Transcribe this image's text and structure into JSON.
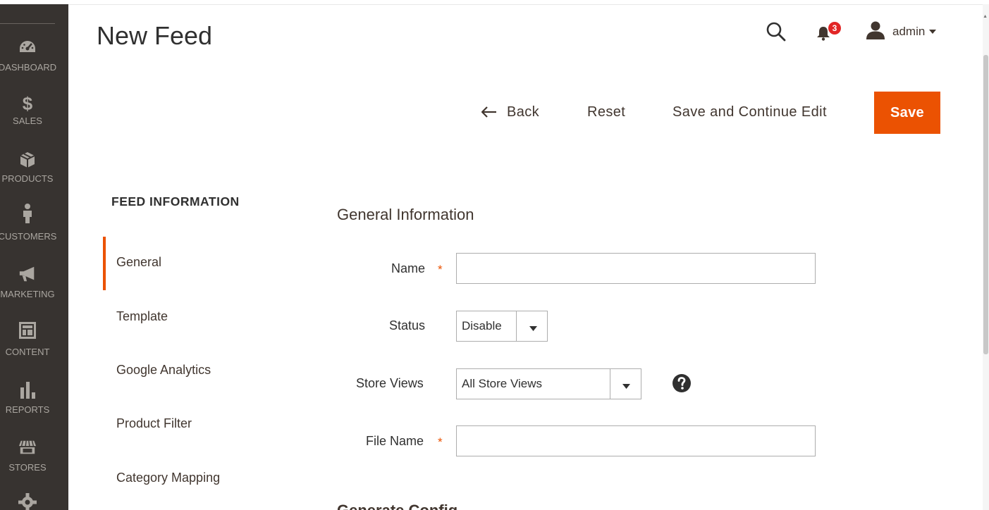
{
  "page": {
    "title": "New Feed"
  },
  "sidebar": {
    "items": [
      {
        "label": "DASHBOARD",
        "icon": "dashboard-icon"
      },
      {
        "label": "SALES",
        "icon": "dollar-icon"
      },
      {
        "label": "PRODUCTS",
        "icon": "box-icon"
      },
      {
        "label": "CUSTOMERS",
        "icon": "person-icon"
      },
      {
        "label": "MARKETING",
        "icon": "megaphone-icon"
      },
      {
        "label": "CONTENT",
        "icon": "layout-icon"
      },
      {
        "label": "REPORTS",
        "icon": "bar-chart-icon"
      },
      {
        "label": "STORES",
        "icon": "storefront-icon"
      }
    ]
  },
  "header": {
    "notifications_count": "3",
    "user_name": "admin"
  },
  "actions": {
    "back_label": "Back",
    "reset_label": "Reset",
    "save_continue_label": "Save and Continue Edit",
    "save_label": "Save"
  },
  "tabs": {
    "title": "FEED INFORMATION",
    "items": [
      {
        "label": "General"
      },
      {
        "label": "Template"
      },
      {
        "label": "Google Analytics"
      },
      {
        "label": "Product Filter"
      },
      {
        "label": "Category Mapping"
      }
    ]
  },
  "form": {
    "section_title": "General Information",
    "name": {
      "label": "Name",
      "value": ""
    },
    "status": {
      "label": "Status",
      "value": "Disable"
    },
    "store_views": {
      "label": "Store Views",
      "value": "All Store Views"
    },
    "file_name": {
      "label": "File Name",
      "value": ""
    },
    "next_section_title": "Generate Config"
  },
  "colors": {
    "sidebar_bg": "#373330",
    "accent": "#eb5202",
    "badge": "#e22626"
  }
}
